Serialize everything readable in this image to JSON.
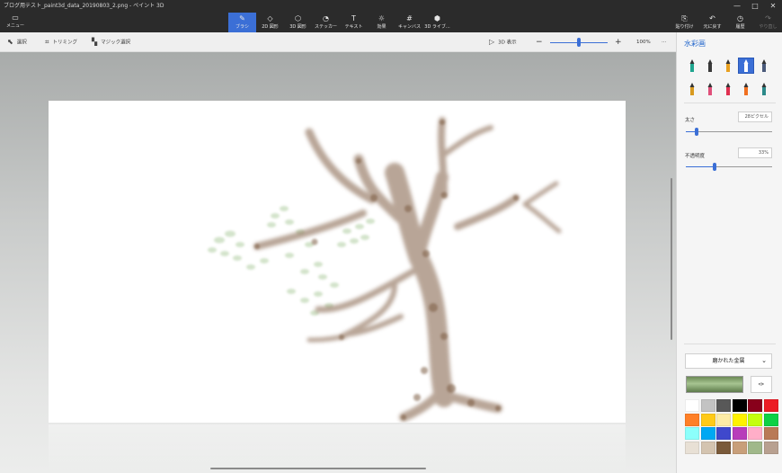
{
  "window": {
    "title": "ブログ用テスト_paint3d_data_20190803_2.png - ペイント 3D",
    "controls": [
      "—",
      "□",
      "✕"
    ]
  },
  "ribbon": {
    "menu": {
      "icon": "▭",
      "label": "メニュー"
    },
    "tools": [
      {
        "name": "brush",
        "icon": "✎",
        "label": "ブラシ",
        "active": true
      },
      {
        "name": "2d-shapes",
        "icon": "◇",
        "label": "2D 図形"
      },
      {
        "name": "3d-shapes",
        "icon": "⬡",
        "label": "3D 図形"
      },
      {
        "name": "stickers",
        "icon": "◔",
        "label": "ステッカー"
      },
      {
        "name": "text",
        "icon": "T",
        "label": "テキスト"
      },
      {
        "name": "effects",
        "icon": "☼",
        "label": "効果"
      },
      {
        "name": "canvas",
        "icon": "#",
        "label": "キャンバス"
      },
      {
        "name": "3d-library",
        "icon": "⬢",
        "label": "3D ライブ..."
      }
    ],
    "right_tools": [
      {
        "name": "paste",
        "icon": "⎘",
        "label": "貼り付け"
      },
      {
        "name": "undo",
        "icon": "↶",
        "label": "元に戻す"
      },
      {
        "name": "history",
        "icon": "◷",
        "label": "履歴"
      },
      {
        "name": "redo",
        "icon": "↷",
        "label": "やり直し",
        "disabled": true
      }
    ]
  },
  "subbar": {
    "select": {
      "icon": "⬉",
      "label": "選択"
    },
    "crop": {
      "icon": "⌗",
      "label": "トリミング"
    },
    "magic": {
      "icon": "▚",
      "label": "マジック選択"
    },
    "view3d": {
      "icon": "▷",
      "label": "3D 表示"
    },
    "zoom_out": "−",
    "zoom_in": "+",
    "zoom": "100%",
    "zoom_fraction": 0.5,
    "more": "···"
  },
  "panel": {
    "title": "水彩画",
    "brushes": [
      {
        "name": "marker",
        "color": "#1fa58f"
      },
      {
        "name": "calligraphy-pen",
        "color": "#3a3a3a"
      },
      {
        "name": "oil-brush",
        "color": "#e8a020"
      },
      {
        "name": "watercolor",
        "color": "#ffffff",
        "active": true
      },
      {
        "name": "pixel-pen",
        "color": "#4a5a7a"
      },
      {
        "name": "pencil",
        "color": "#d89a20"
      },
      {
        "name": "eraser",
        "color": "#e0507a"
      },
      {
        "name": "crayon",
        "color": "#e03050"
      },
      {
        "name": "spray-can",
        "color": "#f07020"
      },
      {
        "name": "fill",
        "color": "#2c8a8a"
      }
    ],
    "size": {
      "label": "太さ",
      "value": "28ピクセル",
      "fraction": 0.13
    },
    "opacity": {
      "label": "不透明度",
      "value": "33%",
      "fraction": 0.33
    },
    "finish": "磨かれた金属",
    "picker_icon": "✑",
    "palette": [
      "#ffffff",
      "#c3c3c3",
      "#585858",
      "#000000",
      "#88001b",
      "#ec1c24",
      "#ff7f27",
      "#ffca18",
      "#fdeca6",
      "#fff200",
      "#c4ff0e",
      "#0ed145",
      "#8cfffb",
      "#00a8f3",
      "#3f48cc",
      "#b83dba",
      "#ffaec8",
      "#b97a56",
      "#e8e0d5",
      "#d4c4b0",
      "#7a5a3a",
      "#c89f7a",
      "#a0b88a",
      "#b8a090"
    ]
  }
}
